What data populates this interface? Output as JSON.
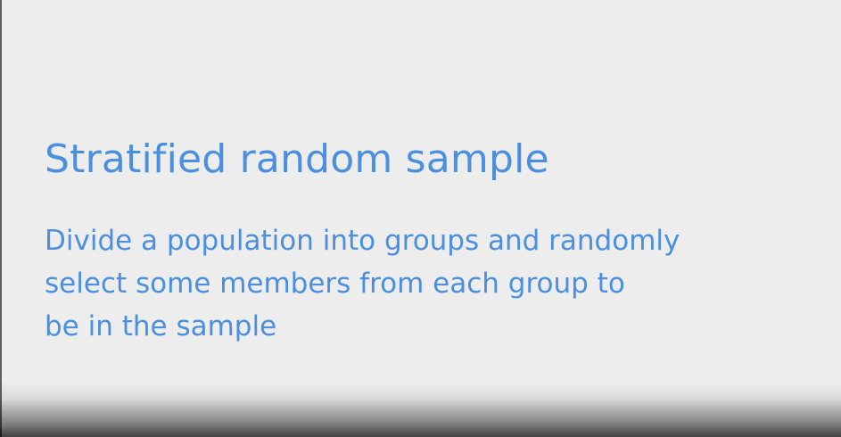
{
  "slide": {
    "title": "Stratified random sample",
    "description_lines": [
      "Divide a population into groups and randomly",
      "select some members from each group to",
      "be in the sample"
    ]
  }
}
